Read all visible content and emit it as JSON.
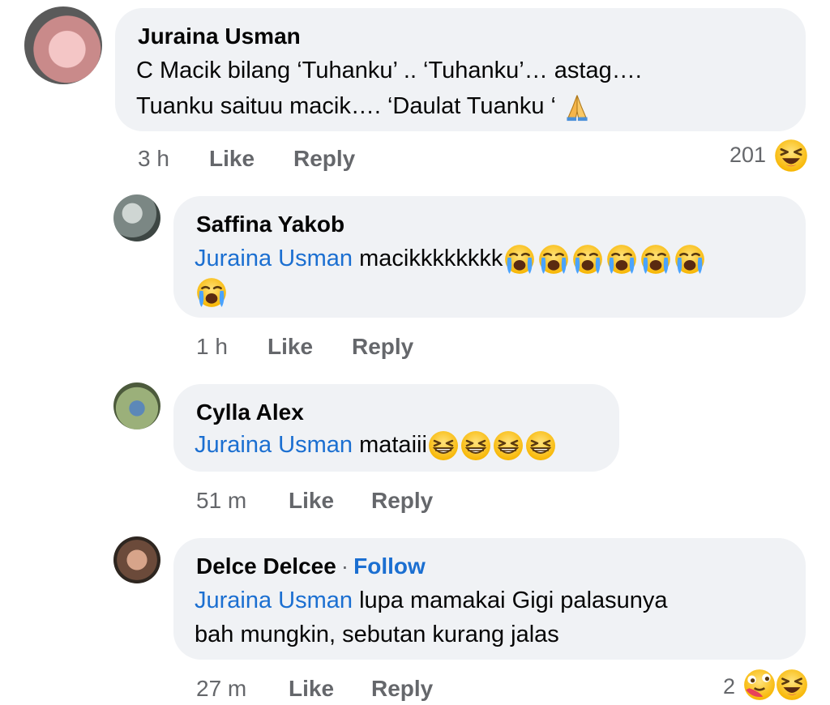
{
  "comments": [
    {
      "author": "Juraina Usman",
      "line1": "C Macik bilang ‘Tuhanku’ .. ‘Tuhanku’… astag….",
      "line2": "Tuanku saituu macik…. ‘Daulat Tuanku ‘",
      "time": "3 h",
      "like": "Like",
      "reply": "Reply",
      "reactions_count": "201"
    },
    {
      "author": "Saffina Yakob",
      "mention": "Juraina Usman",
      "text": "macikkkkkkkk",
      "time": "1 h",
      "like": "Like",
      "reply": "Reply"
    },
    {
      "author": "Cylla Alex",
      "mention": "Juraina Usman",
      "text": "mataiii",
      "time": "51 m",
      "like": "Like",
      "reply": "Reply"
    },
    {
      "author": "Delce Delcee",
      "follow": "Follow",
      "separator": "·",
      "mention": "Juraina Usman",
      "line1": "lupa mamakai Gigi palasunya",
      "line2": "bah mungkin, sebutan kurang jalas",
      "time": "27 m",
      "like": "Like",
      "reply": "Reply",
      "reactions_count": "2"
    }
  ],
  "icons": [
    "praying-hands-icon",
    "laughing-face-icon",
    "crying-face-icon",
    "grinning-squint-icon",
    "hugging-face-icon"
  ],
  "colors": {
    "bubble": "#f0f2f5",
    "mention": "#1b6fd1",
    "meta": "#65676b"
  }
}
